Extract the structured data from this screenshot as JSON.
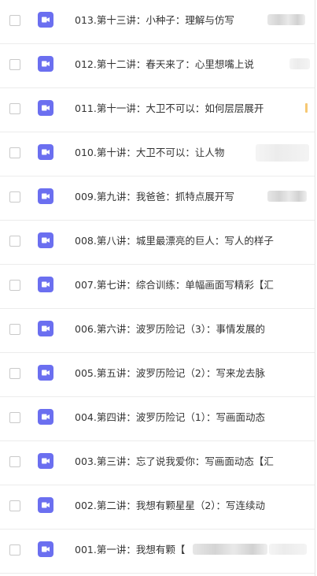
{
  "lessons": [
    {
      "title": "013.第十三讲：小种子：理解与仿写",
      "icon": "video-icon"
    },
    {
      "title": "012.第十二讲：春天来了：心里想嘴上说",
      "icon": "video-icon"
    },
    {
      "title": "011.第十一讲：大卫不可以：如何层层展开",
      "icon": "video-icon"
    },
    {
      "title": "010.第十讲：大卫不可以：让人物",
      "icon": "video-icon"
    },
    {
      "title": "009.第九讲：我爸爸：抓特点展开写",
      "icon": "video-icon"
    },
    {
      "title": "008.第八讲：城里最漂亮的巨人：写人的样子",
      "icon": "video-icon"
    },
    {
      "title": "007.第七讲：综合训练：单幅画面写精彩【汇",
      "icon": "video-icon"
    },
    {
      "title": "006.第六讲：波罗历险记（3）：事情发展的",
      "icon": "video-icon"
    },
    {
      "title": "005.第五讲：波罗历险记（2）：写来龙去脉",
      "icon": "video-icon"
    },
    {
      "title": "004.第四讲：波罗历险记（1）：写画面动态",
      "icon": "video-icon"
    },
    {
      "title": "003.第三讲：忘了说我爱你：写画面动态【汇",
      "icon": "video-icon"
    },
    {
      "title": "002.第二讲：我想有颗星星（2）：写连续动",
      "icon": "video-icon"
    },
    {
      "title": "001.第一讲：我想有颗【",
      "icon": "video-icon"
    }
  ],
  "colors": {
    "icon_bg": "#6b6ff0",
    "text": "#333333",
    "divider": "#ececec"
  }
}
